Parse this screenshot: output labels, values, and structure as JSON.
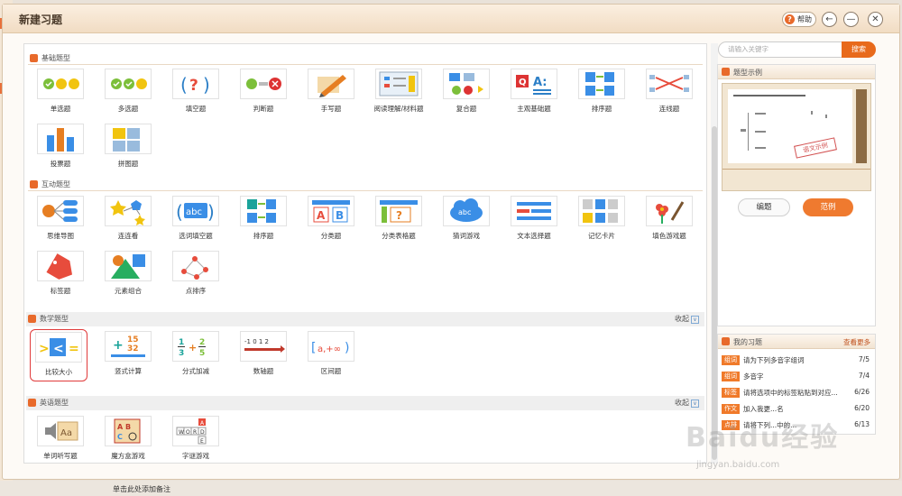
{
  "dialog": {
    "title": "新建习题",
    "help_label": "帮助",
    "back_icon": "arrow-left-icon",
    "minimize_icon": "minus-icon",
    "close_icon": "close-icon"
  },
  "sections": {
    "basic": {
      "title": "基础题型",
      "items": [
        "单选题",
        "多选题",
        "填空题",
        "判断题",
        "手写题",
        "阅读理解/材料题",
        "复合题",
        "主观基础题",
        "排序题",
        "连线题",
        "投票题",
        "拼图题"
      ]
    },
    "interactive": {
      "title": "互动题型",
      "items": [
        "思维导图",
        "连连看",
        "选词填空题",
        "排序题",
        "分类题",
        "分类表格题",
        "猜词游戏",
        "文本选择题",
        "记忆卡片",
        "填色游戏题",
        "标签题",
        "元素组合",
        "点排序"
      ]
    },
    "math": {
      "title": "数学题型",
      "collapse_label": "收起",
      "items": [
        "比较大小",
        "竖式计算",
        "分式加减",
        "数轴题",
        "区间题"
      ]
    },
    "english": {
      "title": "英语题型",
      "collapse_label": "收起",
      "items": [
        "单词听写题",
        "魔方盒游戏",
        "字谜游戏"
      ]
    }
  },
  "search": {
    "placeholder": "请输入关键字",
    "button_label": "搜索"
  },
  "example_panel": {
    "title": "题型示例",
    "stamp_text": "语文示例",
    "edit_label": "编题",
    "example_label": "范例"
  },
  "my_exercises": {
    "title": "我的习题",
    "more_label": "查看更多",
    "items": [
      {
        "tag": "组词",
        "title": "请为下列多音字组词",
        "date": "7/5"
      },
      {
        "tag": "组词",
        "title": "多音字",
        "date": "7/4"
      },
      {
        "tag": "标签",
        "title": "请将选项中的标签粘贴到对应...",
        "date": "6/26"
      },
      {
        "tag": "作文",
        "title": "加入我更...名",
        "date": "6/20"
      },
      {
        "tag": "点排",
        "title": "请将下列...中的...",
        "date": "6/13"
      }
    ]
  },
  "footer": {
    "note": "单击此处添加备注"
  },
  "watermark": {
    "brand": "Baidu经验",
    "url": "jingyan.baidu.com"
  },
  "colors": {
    "accent": "#e86a1c",
    "tag": "#f07a2a",
    "selected_border": "#e03b3b"
  }
}
